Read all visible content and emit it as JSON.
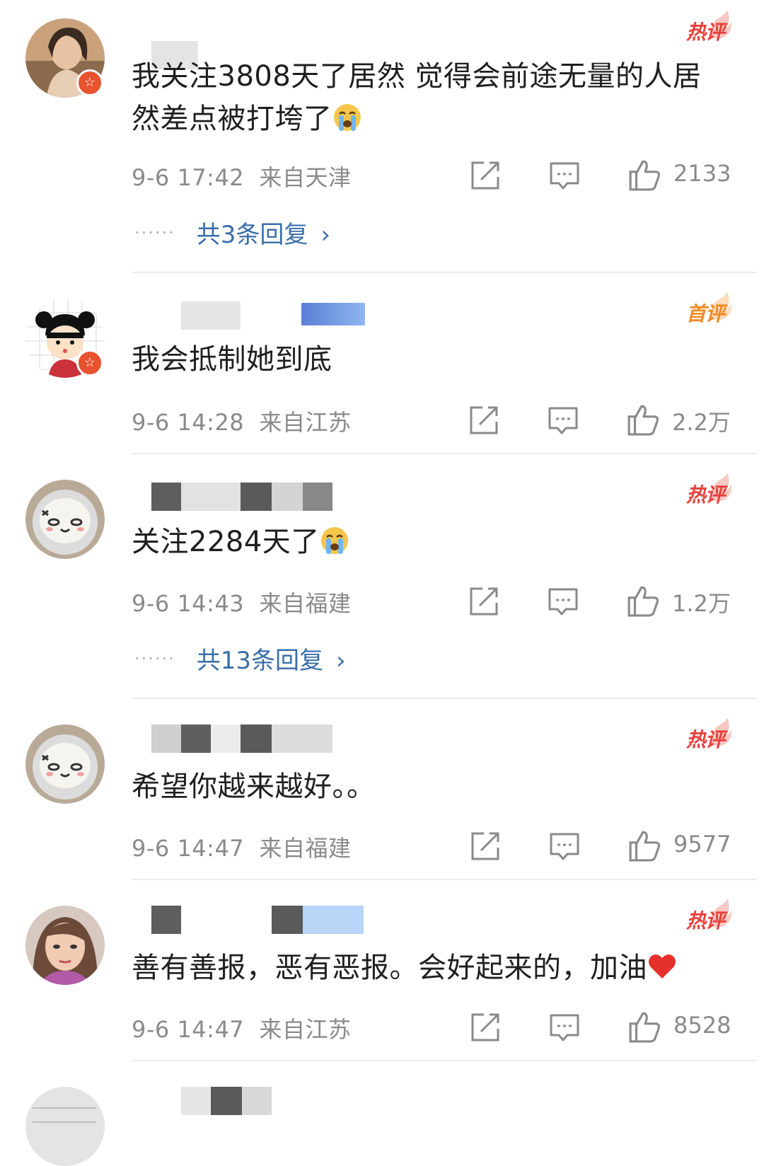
{
  "comments": [
    {
      "tag": "热评",
      "text": "我关注3808天了居然 觉得会前途无量的人居然差点被打垮了",
      "date": "9-6 17:42",
      "location": "来自天津",
      "likes": "2133",
      "replies": "共3条回复"
    },
    {
      "tag": "首评",
      "text": "我会抵制她到底",
      "date": "9-6 14:28",
      "location": "来自江苏",
      "likes": "2.2万"
    },
    {
      "tag": "热评",
      "text": "关注2284天了",
      "date": "9-6 14:43",
      "location": "来自福建",
      "likes": "1.2万",
      "replies": "共13条回复"
    },
    {
      "tag": "热评",
      "text": "希望你越来越好。。",
      "date": "9-6 14:47",
      "location": "来自福建",
      "likes": "9577"
    },
    {
      "tag": "热评",
      "text": "善有善报，恶有恶报。会好起来的，加油",
      "date": "9-6 14:47",
      "location": "来自江苏",
      "likes": "8528"
    }
  ],
  "colors": {
    "hot_tag": "#e8413b",
    "first_tag": "#f08a24",
    "reply_link": "#3a6ea8",
    "meta_gray": "#8a8a8a"
  },
  "icons": [
    "share-icon",
    "comment-icon",
    "like-icon",
    "chevron-right-icon",
    "crying-emoji",
    "heart-emoji",
    "verified-badge-icon"
  ]
}
